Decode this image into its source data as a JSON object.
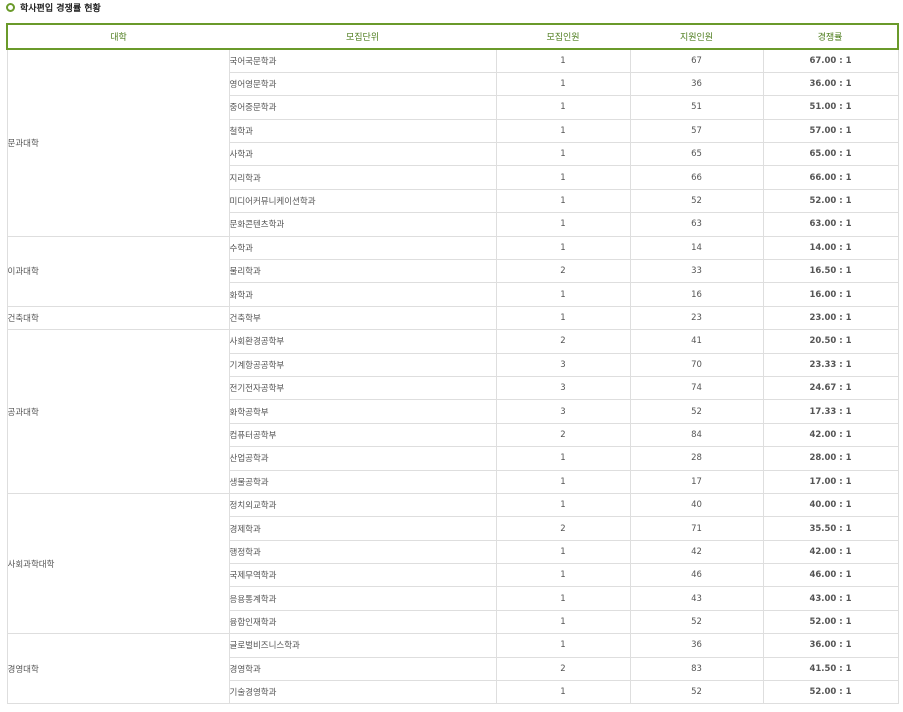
{
  "page": {
    "title": "학사편입 경쟁률 현황"
  },
  "table": {
    "headers": [
      "대학",
      "모집단위",
      "모집인원",
      "지원인원",
      "경쟁률"
    ],
    "groups": [
      {
        "college": "문과대학",
        "rows": [
          {
            "unit": "국어국문학과",
            "quota": "1",
            "applicants": "67",
            "ratio": "67.00 : 1"
          },
          {
            "unit": "영어영문학과",
            "quota": "1",
            "applicants": "36",
            "ratio": "36.00 : 1"
          },
          {
            "unit": "중어중문학과",
            "quota": "1",
            "applicants": "51",
            "ratio": "51.00 : 1"
          },
          {
            "unit": "철학과",
            "quota": "1",
            "applicants": "57",
            "ratio": "57.00 : 1"
          },
          {
            "unit": "사학과",
            "quota": "1",
            "applicants": "65",
            "ratio": "65.00 : 1"
          },
          {
            "unit": "지리학과",
            "quota": "1",
            "applicants": "66",
            "ratio": "66.00 : 1"
          },
          {
            "unit": "미디어커뮤니케이션학과",
            "quota": "1",
            "applicants": "52",
            "ratio": "52.00 : 1"
          },
          {
            "unit": "문화콘텐츠학과",
            "quota": "1",
            "applicants": "63",
            "ratio": "63.00 : 1"
          }
        ]
      },
      {
        "college": "이과대학",
        "rows": [
          {
            "unit": "수학과",
            "quota": "1",
            "applicants": "14",
            "ratio": "14.00 : 1"
          },
          {
            "unit": "물리학과",
            "quota": "2",
            "applicants": "33",
            "ratio": "16.50 : 1"
          },
          {
            "unit": "화학과",
            "quota": "1",
            "applicants": "16",
            "ratio": "16.00 : 1"
          }
        ]
      },
      {
        "college": "건축대학",
        "rows": [
          {
            "unit": "건축학부",
            "quota": "1",
            "applicants": "23",
            "ratio": "23.00 : 1"
          }
        ]
      },
      {
        "college": "공과대학",
        "rows": [
          {
            "unit": "사회환경공학부",
            "quota": "2",
            "applicants": "41",
            "ratio": "20.50 : 1"
          },
          {
            "unit": "기계항공공학부",
            "quota": "3",
            "applicants": "70",
            "ratio": "23.33 : 1"
          },
          {
            "unit": "전기전자공학부",
            "quota": "3",
            "applicants": "74",
            "ratio": "24.67 : 1"
          },
          {
            "unit": "화학공학부",
            "quota": "3",
            "applicants": "52",
            "ratio": "17.33 : 1"
          },
          {
            "unit": "컴퓨터공학부",
            "quota": "2",
            "applicants": "84",
            "ratio": "42.00 : 1"
          },
          {
            "unit": "산업공학과",
            "quota": "1",
            "applicants": "28",
            "ratio": "28.00 : 1"
          },
          {
            "unit": "생물공학과",
            "quota": "1",
            "applicants": "17",
            "ratio": "17.00 : 1"
          }
        ]
      },
      {
        "college": "사회과학대학",
        "rows": [
          {
            "unit": "정치외교학과",
            "quota": "1",
            "applicants": "40",
            "ratio": "40.00 : 1"
          },
          {
            "unit": "경제학과",
            "quota": "2",
            "applicants": "71",
            "ratio": "35.50 : 1"
          },
          {
            "unit": "행정학과",
            "quota": "1",
            "applicants": "42",
            "ratio": "42.00 : 1"
          },
          {
            "unit": "국제무역학과",
            "quota": "1",
            "applicants": "46",
            "ratio": "46.00 : 1"
          },
          {
            "unit": "응용통계학과",
            "quota": "1",
            "applicants": "43",
            "ratio": "43.00 : 1"
          },
          {
            "unit": "융합인재학과",
            "quota": "1",
            "applicants": "52",
            "ratio": "52.00 : 1"
          }
        ]
      },
      {
        "college": "경영대학",
        "rows": [
          {
            "unit": "글로벌비즈니스학과",
            "quota": "1",
            "applicants": "36",
            "ratio": "36.00 : 1"
          },
          {
            "unit": "경영학과",
            "quota": "2",
            "applicants": "83",
            "ratio": "41.50 : 1"
          },
          {
            "unit": "기술경영학과",
            "quota": "1",
            "applicants": "52",
            "ratio": "52.00 : 1"
          }
        ]
      }
    ]
  }
}
